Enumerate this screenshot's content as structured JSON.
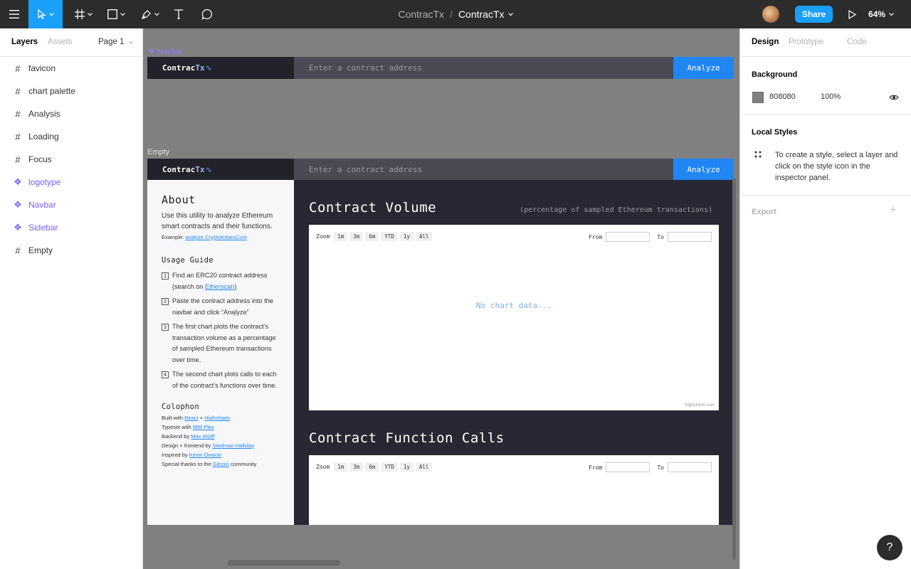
{
  "toolbar": {
    "project_name": "ContracTx",
    "separator": "/",
    "file_name": "ContracTx",
    "share_label": "Share",
    "zoom_level": "64%"
  },
  "left_panel": {
    "tabs": [
      {
        "label": "Layers",
        "active": true
      },
      {
        "label": "Assets",
        "active": false
      }
    ],
    "page_selector": "Page 1",
    "layers": [
      {
        "label": "favicon",
        "type": "frame"
      },
      {
        "label": "chart palette",
        "type": "frame"
      },
      {
        "label": "Analysis",
        "type": "frame"
      },
      {
        "label": "Loading",
        "type": "frame"
      },
      {
        "label": "Focus",
        "type": "frame"
      },
      {
        "label": "logotype",
        "type": "component"
      },
      {
        "label": "Navbar",
        "type": "component"
      },
      {
        "label": "Sidebar",
        "type": "component"
      },
      {
        "label": "Empty",
        "type": "frame"
      }
    ]
  },
  "canvas": {
    "navbar_frame_label": "Navbar",
    "empty_frame_label": "Empty",
    "navbar": {
      "logo_text": "Contrac",
      "logo_accent": "Tx",
      "input_placeholder": "Enter a contract address",
      "button_label": "Analyze"
    },
    "sidebar": {
      "about_heading": "About",
      "about_text": "Use this utility to analyze Ethereum smart contracts and their functions.",
      "example_prefix": "Example: ",
      "example_link": "analyze CryptoKittiesCore",
      "usage_heading": "Usage Guide",
      "steps": [
        {
          "num": "1",
          "text": "Find an ERC20 contract address (search on ",
          "link": "Etherscan",
          "suffix": ")"
        },
        {
          "num": "2",
          "text": "Paste the contract address into the navbar and click “Analyze”",
          "link": "",
          "suffix": ""
        },
        {
          "num": "3",
          "text": "The first chart plots the contract’s transaction volume as a percentage of sampled Ethereum transactions over time.",
          "link": "",
          "suffix": ""
        },
        {
          "num": "4",
          "text": "The second chart plots calls to each of the contract’s functions over time.",
          "link": "",
          "suffix": ""
        }
      ],
      "colophon_heading": "Colophon",
      "colophon": [
        {
          "prefix": "Built with ",
          "link": "React",
          "mid": " + ",
          "link2": "Highcharts",
          "suffix": ""
        },
        {
          "prefix": "Typeset with ",
          "link": "IBM Plex",
          "mid": "",
          "link2": "",
          "suffix": ""
        },
        {
          "prefix": "Backend by ",
          "link": "Max Wolff",
          "mid": "",
          "link2": "",
          "suffix": ""
        },
        {
          "prefix": "Design + frontend by ",
          "link": "Stedman Halliday",
          "mid": "",
          "link2": "",
          "suffix": ""
        },
        {
          "prefix": "Inspired by ",
          "link": "Kevin Owocki",
          "mid": "",
          "link2": "",
          "suffix": ""
        },
        {
          "prefix": "Special thanks to the ",
          "link": "Gitcoin",
          "mid": "",
          "link2": "",
          "suffix": " community"
        }
      ]
    },
    "charts": [
      {
        "title": "Contract Volume",
        "subtitle": "(percentage of sampled Ethereum transactions)",
        "zoom_label": "Zoom",
        "zoom_buttons": [
          "1m",
          "3m",
          "6m",
          "YTD",
          "1y",
          "All"
        ],
        "from_label": "From",
        "to_label": "To",
        "empty_text": "No chart data...",
        "credits": "Highcharts.com"
      },
      {
        "title": "Contract Function Calls",
        "subtitle": "",
        "zoom_label": "Zoom",
        "zoom_buttons": [
          "1m",
          "3m",
          "6m",
          "YTD",
          "1y",
          "All"
        ],
        "from_label": "From",
        "to_label": "To",
        "empty_text": "",
        "credits": ""
      }
    ]
  },
  "right_panel": {
    "tabs": [
      {
        "label": "Design",
        "active": true
      },
      {
        "label": "Prototype",
        "active": false
      },
      {
        "label": "Code",
        "active": false
      }
    ],
    "background_title": "Background",
    "background_hex": "808080",
    "background_opacity": "100%",
    "local_styles_title": "Local Styles",
    "local_styles_text": "To create a style, select a layer and click on the style icon in the inspector panel.",
    "export_title": "Export",
    "help_label": "?"
  },
  "colors": {
    "accent": "#18a0fb",
    "component": "#7b61ff",
    "canvas": "#808080",
    "app_dark": "#272833",
    "analyze_button": "#1f86f4"
  }
}
